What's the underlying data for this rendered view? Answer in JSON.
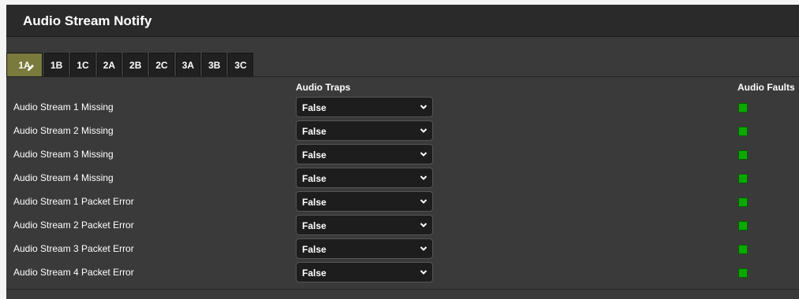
{
  "header": {
    "title": "Audio Stream Notify"
  },
  "tabs": [
    {
      "label": "1A",
      "active": true
    },
    {
      "label": "1B"
    },
    {
      "label": "1C"
    },
    {
      "label": "2A"
    },
    {
      "label": "2B"
    },
    {
      "label": "2C"
    },
    {
      "label": "3A"
    },
    {
      "label": "3B"
    },
    {
      "label": "3C"
    }
  ],
  "columns": {
    "traps": "Audio Traps",
    "faults": "Audio Faults"
  },
  "rows": [
    {
      "label": "Audio Stream 1 Missing",
      "trap": "False",
      "fault_status": "ok"
    },
    {
      "label": "Audio Stream 2 Missing",
      "trap": "False",
      "fault_status": "ok"
    },
    {
      "label": "Audio Stream 3 Missing",
      "trap": "False",
      "fault_status": "ok"
    },
    {
      "label": "Audio Stream 4 Missing",
      "trap": "False",
      "fault_status": "ok"
    },
    {
      "label": "Audio Stream 1 Packet Error",
      "trap": "False",
      "fault_status": "ok"
    },
    {
      "label": "Audio Stream 2 Packet Error",
      "trap": "False",
      "fault_status": "ok"
    },
    {
      "label": "Audio Stream 3 Packet Error",
      "trap": "False",
      "fault_status": "ok"
    },
    {
      "label": "Audio Stream 4 Packet Error",
      "trap": "False",
      "fault_status": "ok"
    }
  ],
  "colors": {
    "panel": "#3a3a3a",
    "header": "#2a2a2a",
    "tab_active": "#7a7a3c",
    "led_ok": "#0ca800"
  },
  "icons": {
    "tab_edit": "pencil-icon",
    "select_arrow": "chevron-down-icon"
  }
}
